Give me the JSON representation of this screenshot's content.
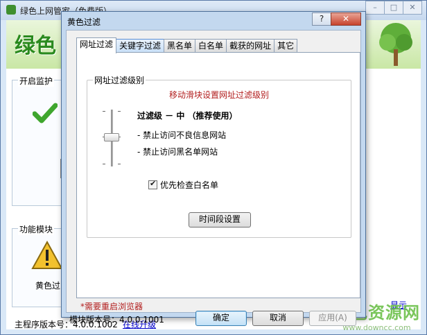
{
  "main_window": {
    "title": "绿色上网管家（免费版）",
    "controls": {
      "minimize": "–",
      "maximize": "□",
      "close": "✕"
    },
    "banner_text": "绿色",
    "monitor_group_label": "开启监护",
    "function_group_label": "功能模块",
    "function_item_label": "黄色过",
    "main_version_label": "主程序版本号：4.0.0.1002",
    "link_text": "在线升级",
    "help_link": "显示"
  },
  "dialog": {
    "title": "黄色过滤",
    "help_button": "?",
    "close_button": "✕",
    "tabs": [
      {
        "label": "网址过滤",
        "active": true
      },
      {
        "label": "关键字过滤",
        "active": false,
        "highlight": true
      },
      {
        "label": "黑名单",
        "active": false
      },
      {
        "label": "白名单",
        "active": false
      },
      {
        "label": "截获的网址",
        "active": false
      },
      {
        "label": "其它",
        "active": false
      }
    ],
    "group_label": "网址过滤级别",
    "hint": "移动滑块设置网址过滤级别",
    "slider_level_fraction": 0.5,
    "level_text": "过滤级 － 中 （推荐使用）",
    "descriptions": [
      "- 禁止访问不良信息网站",
      "- 禁止访问黑名单网站"
    ],
    "whitelist_checkbox": {
      "label": "优先检查白名单",
      "checked": true
    },
    "time_button": "时间段设置",
    "restart_note": "*需要重启浏览器",
    "module_version": "模块版本号：4.0.0.1001",
    "ok_button": "确定",
    "cancel_button": "取消",
    "apply_button": "应用(A)"
  },
  "watermark": {
    "main": "绿色资源网",
    "sub": "www.downcc.com"
  }
}
